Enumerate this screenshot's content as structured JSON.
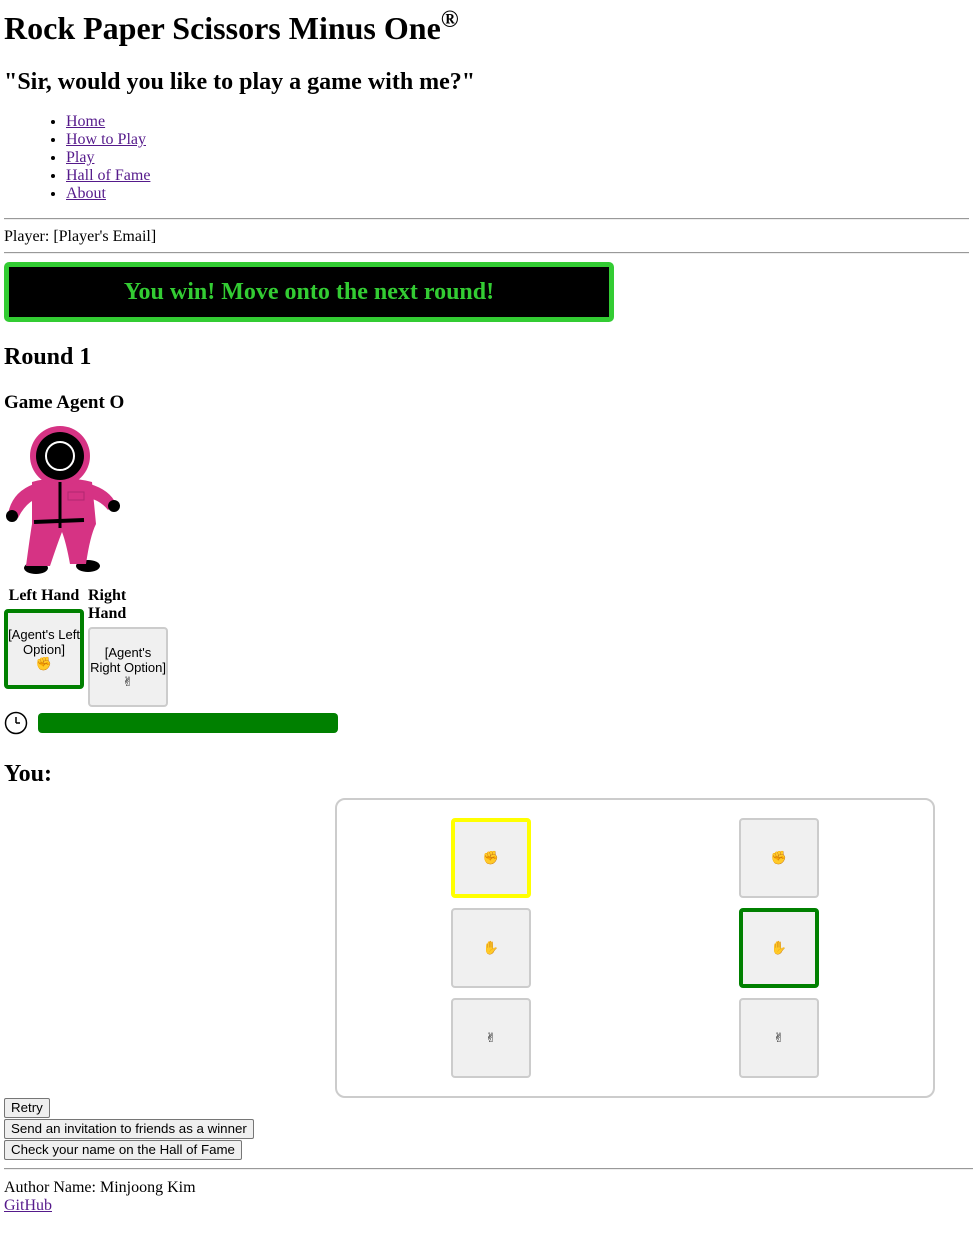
{
  "header": {
    "title": "Rock Paper Scissors Minus One",
    "title_mark": "®",
    "tagline": "\"Sir, would you like to play a game with me?\""
  },
  "nav": {
    "items": [
      "Home",
      "How to Play",
      "Play",
      "Hall of Fame",
      "About"
    ]
  },
  "player": {
    "label": "Player: [Player's Email]"
  },
  "banner": {
    "message": "You win! Move onto the next round!",
    "colors": {
      "text": "#33cc33",
      "background": "#000000",
      "border": "#33cc33"
    }
  },
  "game": {
    "round_label": "Round 1",
    "agent_name": "Game Agent O",
    "agent_figure": "pink-guard-icon",
    "hands": {
      "left": {
        "label": "Left Hand",
        "option": "[Agent's Left Option]",
        "glyph": "✊",
        "selected": true
      },
      "right": {
        "label": "Right Hand",
        "option": "[Agent's Right Option]",
        "glyph": "✌",
        "selected": false
      }
    },
    "timer": {
      "icon": "clock-icon",
      "fill": 1.0,
      "color": "#008000"
    }
  },
  "you": {
    "heading": "You:",
    "choices": {
      "left": [
        {
          "glyph": "✊",
          "state": "highlighted",
          "highlight_color": "#ffff00"
        },
        {
          "glyph": "✋",
          "state": "normal"
        },
        {
          "glyph": "✌",
          "state": "normal"
        }
      ],
      "right": [
        {
          "glyph": "✊",
          "state": "normal"
        },
        {
          "glyph": "✋",
          "state": "selected",
          "highlight_color": "#008000"
        },
        {
          "glyph": "✌",
          "state": "normal"
        }
      ]
    }
  },
  "actions": {
    "retry": "Retry",
    "invite": "Send an invitation to friends as a winner",
    "hall_of_fame": "Check your name on the Hall of Fame"
  },
  "footer": {
    "author": "Author Name: Minjoong Kim",
    "github": "GitHub"
  }
}
